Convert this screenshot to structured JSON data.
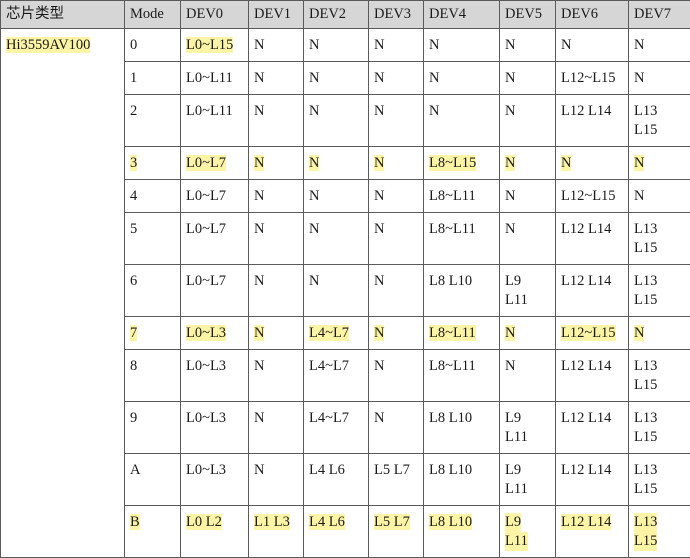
{
  "table": {
    "headers": [
      "芯片类型",
      "Mode",
      "DEV0",
      "DEV1",
      "DEV2",
      "DEV3",
      "DEV4",
      "DEV5",
      "DEV6",
      "DEV7"
    ],
    "chip": "Hi3559AV100",
    "highlight_color": "#fdf4a6",
    "header_bg": "#d6d6d6",
    "rows": [
      {
        "mode": "0",
        "cells": [
          [
            "L0~L15"
          ],
          [
            "N"
          ],
          [
            "N"
          ],
          [
            "N"
          ],
          [
            "N"
          ],
          [
            "N"
          ],
          [
            "N"
          ],
          [
            "N"
          ]
        ],
        "hl": [
          true,
          false,
          false,
          false,
          false,
          false,
          false,
          false
        ],
        "hl_mode": false
      },
      {
        "mode": "1",
        "cells": [
          [
            "L0~L11"
          ],
          [
            "N"
          ],
          [
            "N"
          ],
          [
            "N"
          ],
          [
            "N"
          ],
          [
            "N"
          ],
          [
            "L12~L15"
          ],
          [
            "N"
          ]
        ],
        "hl": [
          false,
          false,
          false,
          false,
          false,
          false,
          false,
          false
        ],
        "hl_mode": false
      },
      {
        "mode": "2",
        "cells": [
          [
            "L0~L11"
          ],
          [
            "N"
          ],
          [
            "N"
          ],
          [
            "N"
          ],
          [
            "N"
          ],
          [
            "N"
          ],
          [
            "L12 L14"
          ],
          [
            "L13",
            "L15"
          ]
        ],
        "hl": [
          false,
          false,
          false,
          false,
          false,
          false,
          false,
          false
        ],
        "hl_mode": false
      },
      {
        "mode": "3",
        "cells": [
          [
            "L0~L7"
          ],
          [
            "N"
          ],
          [
            "N"
          ],
          [
            "N"
          ],
          [
            "L8~L15"
          ],
          [
            "N"
          ],
          [
            "N"
          ],
          [
            "N"
          ]
        ],
        "hl": [
          true,
          true,
          true,
          true,
          true,
          true,
          true,
          true
        ],
        "hl_mode": true
      },
      {
        "mode": "4",
        "cells": [
          [
            "L0~L7"
          ],
          [
            "N"
          ],
          [
            "N"
          ],
          [
            "N"
          ],
          [
            "L8~L11"
          ],
          [
            "N"
          ],
          [
            "L12~L15"
          ],
          [
            "N"
          ]
        ],
        "hl": [
          false,
          false,
          false,
          false,
          false,
          false,
          false,
          false
        ],
        "hl_mode": false
      },
      {
        "mode": "5",
        "cells": [
          [
            "L0~L7"
          ],
          [
            "N"
          ],
          [
            "N"
          ],
          [
            "N"
          ],
          [
            "L8~L11"
          ],
          [
            "N"
          ],
          [
            "L12 L14"
          ],
          [
            "L13",
            "L15"
          ]
        ],
        "hl": [
          false,
          false,
          false,
          false,
          false,
          false,
          false,
          false
        ],
        "hl_mode": false
      },
      {
        "mode": "6",
        "cells": [
          [
            "L0~L7"
          ],
          [
            "N"
          ],
          [
            "N"
          ],
          [
            "N"
          ],
          [
            "L8 L10"
          ],
          [
            "L9",
            "L11"
          ],
          [
            "L12 L14"
          ],
          [
            "L13",
            "L15"
          ]
        ],
        "hl": [
          false,
          false,
          false,
          false,
          false,
          false,
          false,
          false
        ],
        "hl_mode": false
      },
      {
        "mode": "7",
        "cells": [
          [
            "L0~L3"
          ],
          [
            "N"
          ],
          [
            "L4~L7"
          ],
          [
            "N"
          ],
          [
            "L8~L11"
          ],
          [
            "N"
          ],
          [
            "L12~L15"
          ],
          [
            "N"
          ]
        ],
        "hl": [
          true,
          true,
          true,
          true,
          true,
          true,
          true,
          true
        ],
        "hl_mode": true
      },
      {
        "mode": "8",
        "cells": [
          [
            "L0~L3"
          ],
          [
            "N"
          ],
          [
            "L4~L7"
          ],
          [
            "N"
          ],
          [
            "L8~L11"
          ],
          [
            "N"
          ],
          [
            "L12 L14"
          ],
          [
            "L13",
            "L15"
          ]
        ],
        "hl": [
          false,
          false,
          false,
          false,
          false,
          false,
          false,
          false
        ],
        "hl_mode": false
      },
      {
        "mode": "9",
        "cells": [
          [
            "L0~L3"
          ],
          [
            "N"
          ],
          [
            "L4~L7"
          ],
          [
            "N"
          ],
          [
            "L8 L10"
          ],
          [
            "L9",
            "L11"
          ],
          [
            "L12 L14"
          ],
          [
            "L13",
            "L15"
          ]
        ],
        "hl": [
          false,
          false,
          false,
          false,
          false,
          false,
          false,
          false
        ],
        "hl_mode": false
      },
      {
        "mode": "A",
        "cells": [
          [
            "L0~L3"
          ],
          [
            "N"
          ],
          [
            "L4 L6"
          ],
          [
            "L5 L7"
          ],
          [
            "L8 L10"
          ],
          [
            "L9",
            "L11"
          ],
          [
            "L12 L14"
          ],
          [
            "L13",
            "L15"
          ]
        ],
        "hl": [
          false,
          false,
          false,
          false,
          false,
          false,
          false,
          false
        ],
        "hl_mode": false
      },
      {
        "mode": "B",
        "cells": [
          [
            "L0 L2"
          ],
          [
            "L1 L3"
          ],
          [
            "L4 L6"
          ],
          [
            "L5 L7"
          ],
          [
            "L8 L10"
          ],
          [
            "L9",
            "L11"
          ],
          [
            "L12 L14"
          ],
          [
            "L13",
            "L15"
          ]
        ],
        "hl": [
          true,
          true,
          true,
          true,
          true,
          true,
          true,
          true
        ],
        "hl_mode": true
      }
    ]
  }
}
